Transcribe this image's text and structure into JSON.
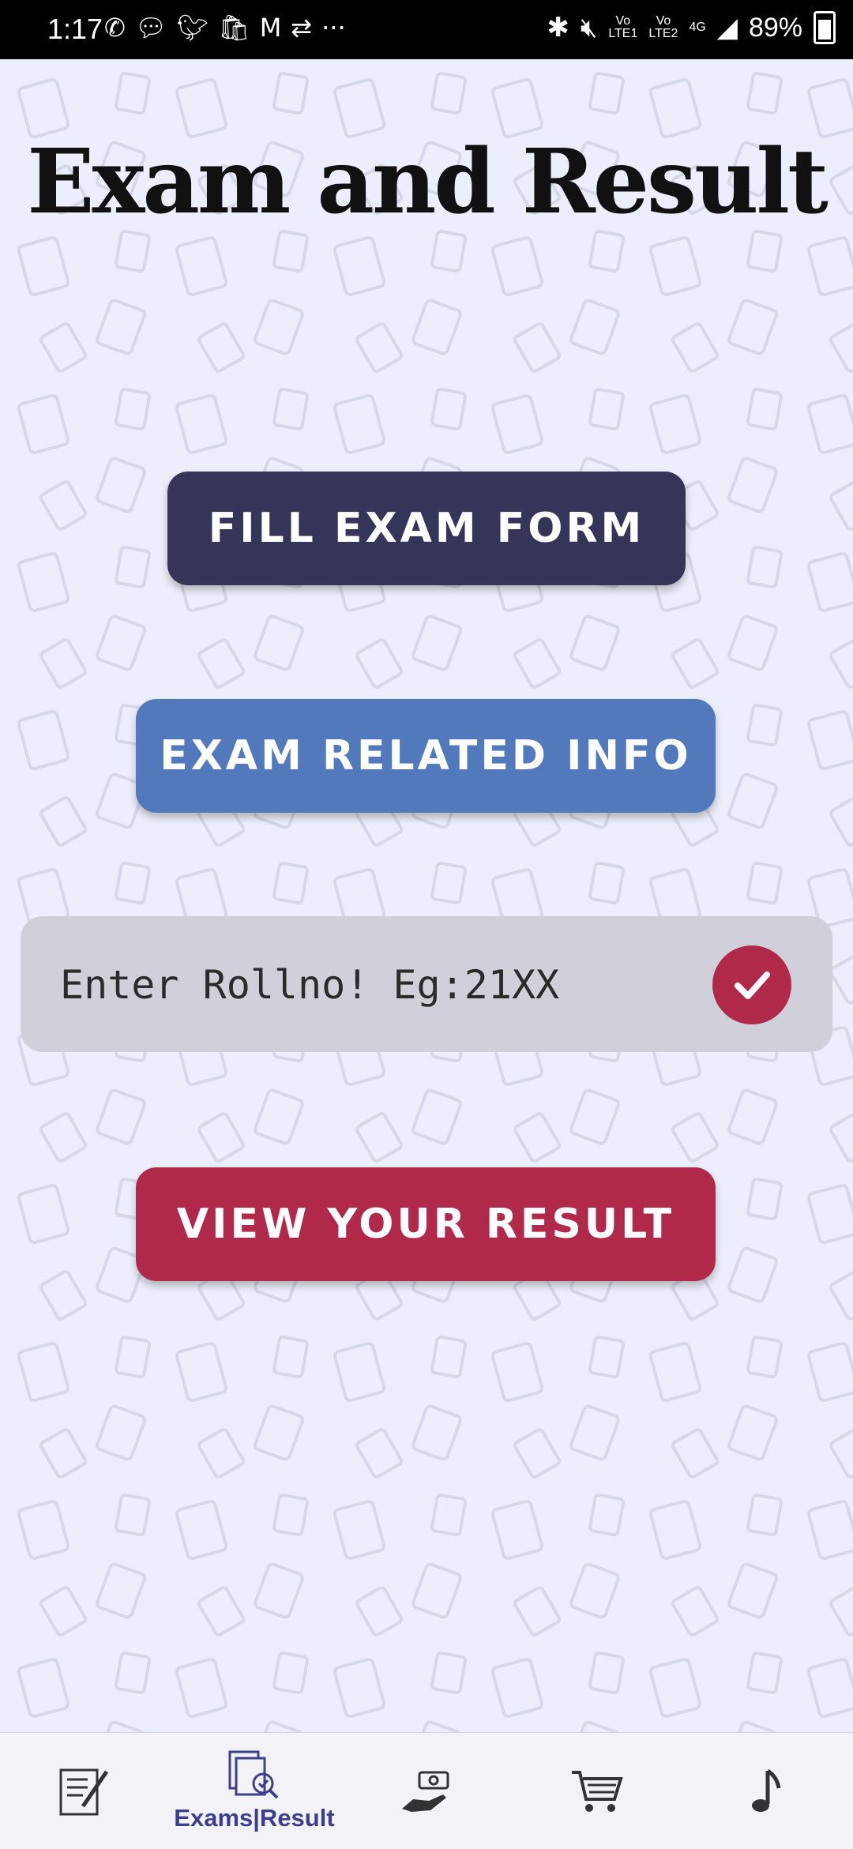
{
  "status_bar": {
    "time": "1:17",
    "left_icons": [
      "whatsapp-icon",
      "chat-icon",
      "twitter-icon",
      "shopping-icon",
      "gmail-icon",
      "usb-icon",
      "more-icon"
    ],
    "lte1": "Vo\nLTE1",
    "lte2": "Vo\nLTE2",
    "network": "4G",
    "battery": "89%"
  },
  "page": {
    "title": "Exam and Result"
  },
  "buttons": {
    "fill_exam_form": "FILL EXAM FORM",
    "exam_related_info": "EXAM RELATED INFO",
    "view_result": "VIEW YOUR RESULT"
  },
  "rollno": {
    "placeholder": "Enter Rollno! Eg:21XX",
    "value": ""
  },
  "bottom_nav": {
    "items": [
      {
        "icon": "notes-pen-icon",
        "label": ""
      },
      {
        "icon": "exam-result-icon",
        "label": "Exams|Result"
      },
      {
        "icon": "payment-hand-icon",
        "label": ""
      },
      {
        "icon": "cart-icon",
        "label": ""
      },
      {
        "icon": "music-note-icon",
        "label": ""
      }
    ],
    "active_index": 1
  },
  "colors": {
    "background": "#eceffb",
    "fill_button": "#35355a",
    "info_button": "#5379bd",
    "result_button": "#b1294a",
    "nav_accent": "#3c3f8c"
  }
}
